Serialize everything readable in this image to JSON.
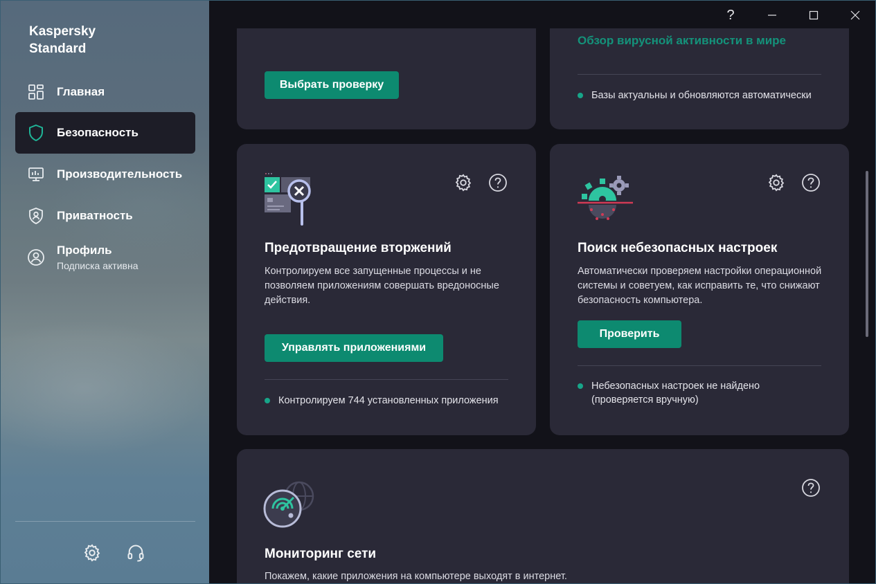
{
  "app": {
    "brand_line1": "Kaspersky",
    "brand_line2": "Standard"
  },
  "titlebar": {
    "help": "?",
    "minimize": "–",
    "maximize": "☐",
    "close": "✕"
  },
  "sidebar": {
    "items": [
      {
        "label": "Главная",
        "icon": "dashboard-icon"
      },
      {
        "label": "Безопасность",
        "icon": "shield-icon",
        "active": true
      },
      {
        "label": "Производительность",
        "icon": "monitor-icon"
      },
      {
        "label": "Приватность",
        "icon": "privacy-shield-icon"
      },
      {
        "label": "Профиль",
        "sublabel": "Подписка активна",
        "icon": "user-icon"
      }
    ],
    "footer_icons": [
      "gear-icon",
      "headset-icon"
    ]
  },
  "scan_card": {
    "button": "Выбрать проверку"
  },
  "virus_card": {
    "link": "Обзор вирусной активности в мире",
    "status": "Базы актуальны и обновляются автоматически"
  },
  "intrusion_card": {
    "title": "Предотвращение вторжений",
    "description": "Контролируем все запущенные процессы и не позволяем приложениям совершать вредоносные действия.",
    "button": "Управлять приложениями",
    "status": "Контролируем 744 установленных приложения"
  },
  "settings_card": {
    "title": "Поиск небезопасных настроек",
    "description": "Автоматически проверяем настройки операционной системы и советуем, как исправить те, что снижают безопасность компьютера.",
    "button": "Проверить",
    "status": "Небезопасных настроек не найдено (проверяется вручную)"
  },
  "network_card": {
    "title": "Мониторинг сети",
    "description": "Покажем, какие приложения на компьютере выходят в интернет."
  },
  "colors": {
    "accent": "#0d8a70",
    "accent_text": "#14927a",
    "card_bg": "#2a2937",
    "app_bg": "#121219",
    "status_dot": "#17a589"
  }
}
